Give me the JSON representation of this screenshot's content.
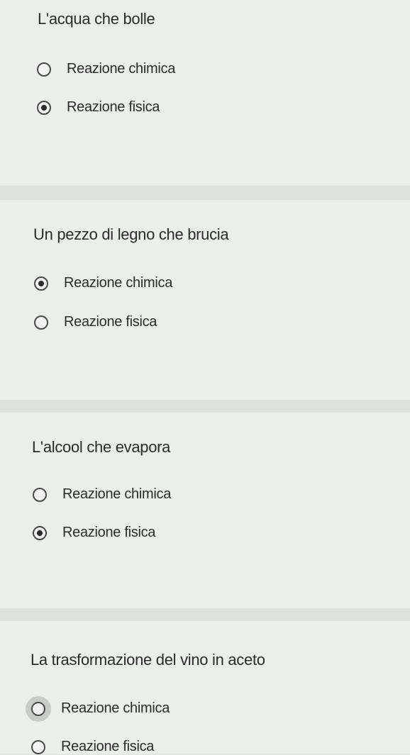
{
  "questions": [
    {
      "text": "L'acqua che bolle",
      "options": [
        {
          "label": "Reazione chimica",
          "selected": false
        },
        {
          "label": "Reazione fisica",
          "selected": true
        }
      ]
    },
    {
      "text": "Un pezzo di legno che brucia",
      "options": [
        {
          "label": "Reazione chimica",
          "selected": true
        },
        {
          "label": "Reazione fisica",
          "selected": false
        }
      ]
    },
    {
      "text": "L'alcool che evapora",
      "options": [
        {
          "label": "Reazione chimica",
          "selected": false
        },
        {
          "label": "Reazione fisica",
          "selected": true
        }
      ]
    },
    {
      "text": "La trasformazione del vino in aceto",
      "options": [
        {
          "label": "Reazione chimica",
          "selected": false
        },
        {
          "label": "Reazione fisica",
          "selected": false
        }
      ]
    }
  ]
}
